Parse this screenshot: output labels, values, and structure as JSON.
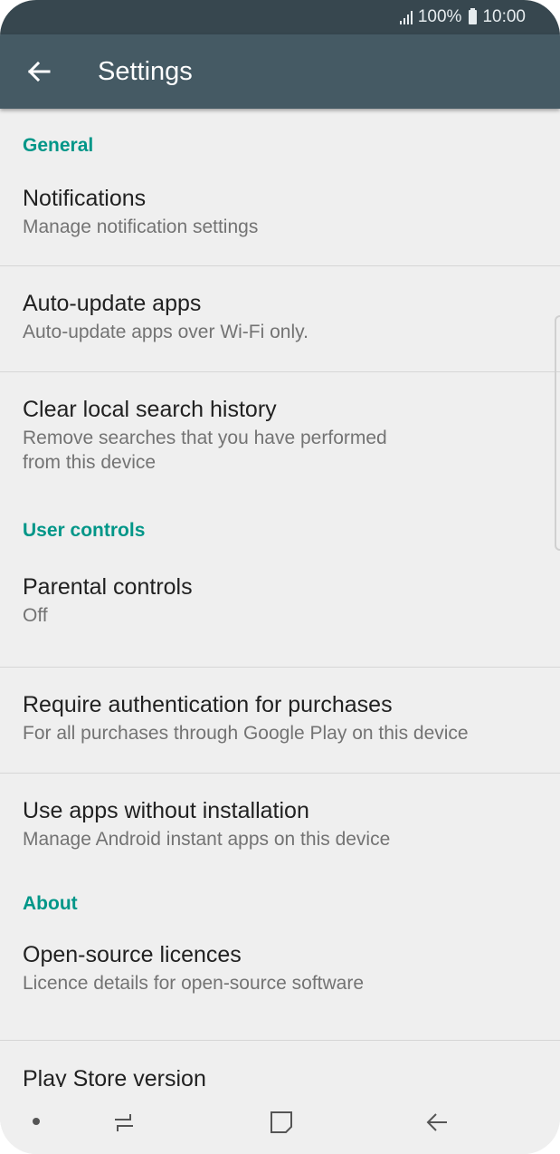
{
  "status_bar": {
    "battery_percent": "100%",
    "time": "10:00"
  },
  "app_bar": {
    "title": "Settings"
  },
  "sections": {
    "general": {
      "header": "General",
      "notifications": {
        "title": "Notifications",
        "subtitle": "Manage notification settings"
      },
      "auto_update": {
        "title": "Auto-update apps",
        "subtitle": "Auto-update apps over Wi-Fi only."
      },
      "clear_history": {
        "title": "Clear local search history",
        "subtitle": "Remove searches that you have performed\nfrom this device"
      }
    },
    "user_controls": {
      "header": "User controls",
      "parental": {
        "title": "Parental controls",
        "subtitle": "Off"
      },
      "require_auth": {
        "title": "Require authentication for purchases",
        "subtitle": "For all purchases through Google Play on this device"
      },
      "instant_apps": {
        "title": "Use apps without installation",
        "subtitle": "Manage Android instant apps on this device"
      }
    },
    "about": {
      "header": "About",
      "licences": {
        "title": "Open-source licences",
        "subtitle": "Licence details for open-source software"
      },
      "version": {
        "title": "Play Store version"
      }
    }
  },
  "nav_bar": {
    "icons": [
      "dot-icon",
      "recents-icon",
      "home-icon",
      "back-icon"
    ]
  },
  "colors": {
    "status_bar": "#37474f",
    "app_bar": "#455a64",
    "accent": "#009688",
    "background": "#efefef"
  }
}
